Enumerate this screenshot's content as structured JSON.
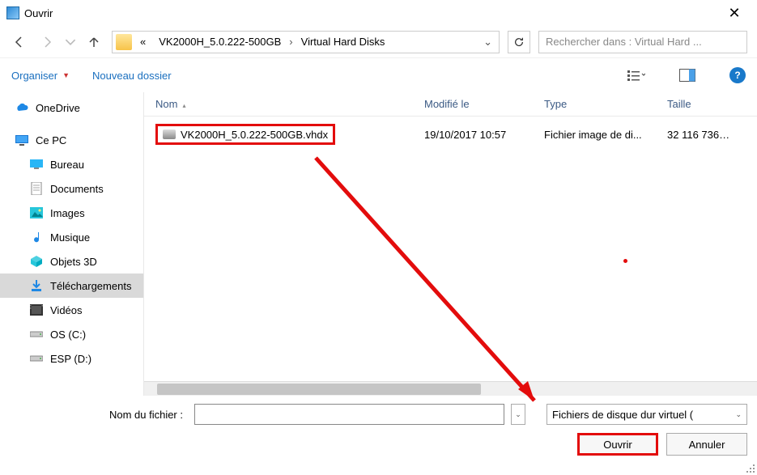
{
  "window": {
    "title": "Ouvrir"
  },
  "nav": {
    "breadcrumb_prefix": "«",
    "crumb1": "VK2000H_5.0.222-500GB",
    "crumb2": "Virtual Hard Disks",
    "search_placeholder": "Rechercher dans : Virtual Hard ..."
  },
  "toolbar": {
    "organize": "Organiser",
    "new_folder": "Nouveau dossier"
  },
  "sidebar": {
    "items": [
      {
        "label": "OneDrive"
      },
      {
        "label": "Ce PC"
      },
      {
        "label": "Bureau"
      },
      {
        "label": "Documents"
      },
      {
        "label": "Images"
      },
      {
        "label": "Musique"
      },
      {
        "label": "Objets 3D"
      },
      {
        "label": "Téléchargements"
      },
      {
        "label": "Vidéos"
      },
      {
        "label": "OS (C:)"
      },
      {
        "label": "ESP (D:)"
      }
    ]
  },
  "columns": {
    "name": "Nom",
    "modified": "Modifié le",
    "type": "Type",
    "size": "Taille"
  },
  "files": [
    {
      "name": "VK2000H_5.0.222-500GB.vhdx",
      "modified": "19/10/2017 10:57",
      "type": "Fichier image de di...",
      "size": "32 116 736 ..."
    }
  ],
  "bottom": {
    "filename_label": "Nom du fichier :",
    "filetype": "Fichiers de disque dur virtuel  (",
    "open": "Ouvrir",
    "cancel": "Annuler"
  }
}
